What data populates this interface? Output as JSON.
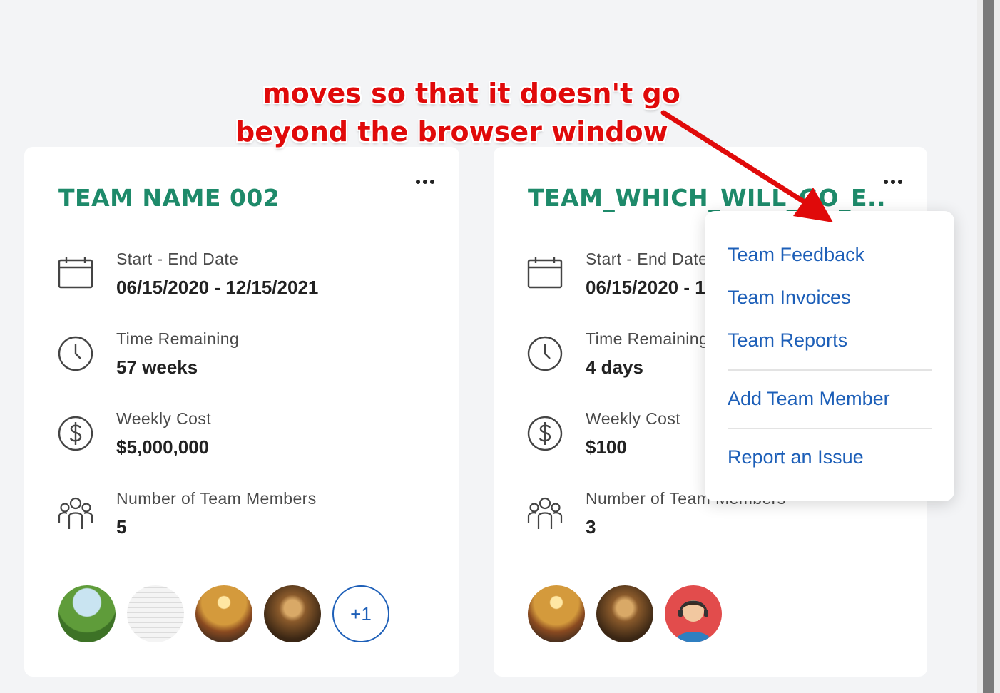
{
  "annotation": {
    "line1": "moves so that it doesn't go",
    "line2": "beyond the browser window",
    "color": "#e00a0a"
  },
  "cards": [
    {
      "title": "TEAM NAME 002",
      "menu_icon": "more-horizontal-icon",
      "fields": [
        {
          "icon": "calendar-icon",
          "label": "Start - End Date",
          "value": "06/15/2020 - 12/15/2021"
        },
        {
          "icon": "clock-icon",
          "label": "Time Remaining",
          "value": "57 weeks"
        },
        {
          "icon": "dollar-icon",
          "label": "Weekly Cost",
          "value": "$5,000,000"
        },
        {
          "icon": "team-icon",
          "label": "Number of Team Members",
          "value": "5"
        }
      ],
      "avatars": [
        "landscape-avatar",
        "spreadsheet-avatar",
        "sunglasses-avatar",
        "cathedral-avatar"
      ],
      "more_count": "+1"
    },
    {
      "title": "TEAM_WHICH_WILL_GO_E...",
      "menu_icon": "more-horizontal-icon",
      "fields": [
        {
          "icon": "calendar-icon",
          "label": "Start - End Date",
          "value": "06/15/2020 - 12/15/2021"
        },
        {
          "icon": "clock-icon",
          "label": "Time Remaining",
          "value": "4 days"
        },
        {
          "icon": "dollar-icon",
          "label": "Weekly Cost",
          "value": "$100"
        },
        {
          "icon": "team-icon",
          "label": "Number of Team Members",
          "value": "3"
        }
      ],
      "avatars": [
        "sunglasses-avatar",
        "cathedral-avatar",
        "support-agent-avatar"
      ]
    }
  ],
  "menu": {
    "items": [
      "Team Feedback",
      "Team Invoices",
      "Team Reports",
      "Add Team Member",
      "Report an Issue"
    ],
    "link_color": "#1d5fb8"
  },
  "colors": {
    "title": "#1e8a6a",
    "background": "#f3f4f6"
  }
}
